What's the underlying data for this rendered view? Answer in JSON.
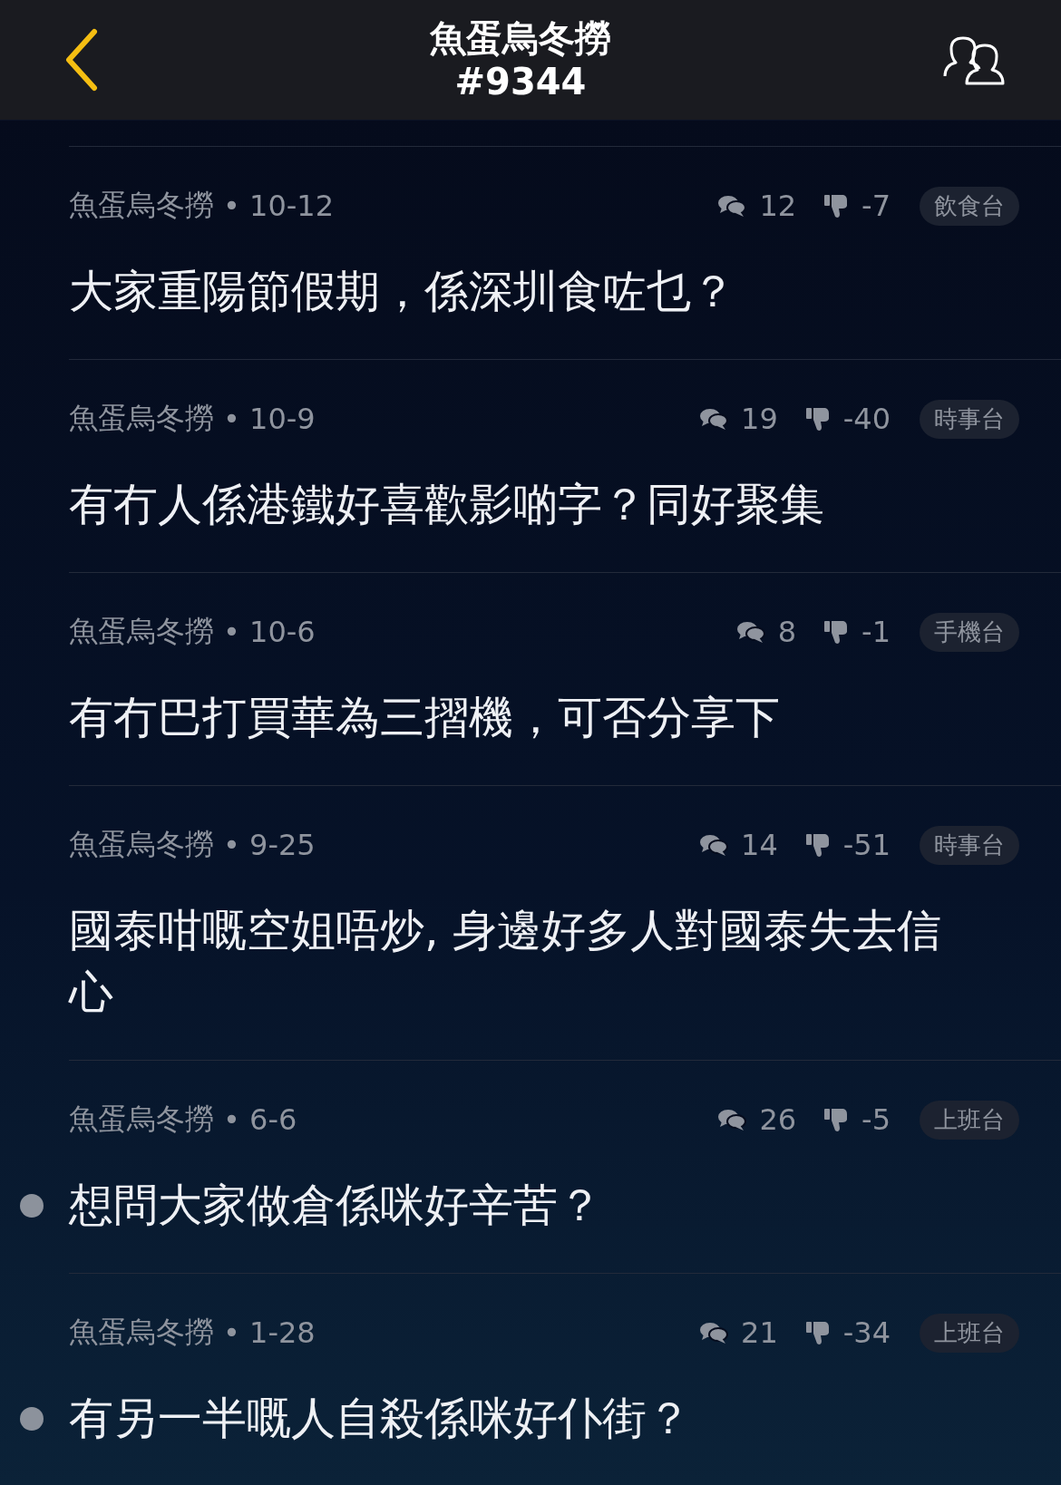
{
  "header": {
    "title": "魚蛋烏冬撈",
    "subtitle": "#9344"
  },
  "posts": [
    {
      "author": "魚蛋烏冬撈",
      "date": "• 10-12",
      "comments": "12",
      "score": "-7",
      "board": "飲食台",
      "title": "大家重陽節假期，係深圳食咗乜？",
      "unread": false
    },
    {
      "author": "魚蛋烏冬撈",
      "date": "• 10-9",
      "comments": "19",
      "score": "-40",
      "board": "時事台",
      "title": "有冇人係港鐵好喜歡影啲字？同好聚集",
      "unread": false
    },
    {
      "author": "魚蛋烏冬撈",
      "date": "• 10-6",
      "comments": "8",
      "score": "-1",
      "board": "手機台",
      "title": "有冇巴打買華為三摺機，可否分享下",
      "unread": false
    },
    {
      "author": "魚蛋烏冬撈",
      "date": "• 9-25",
      "comments": "14",
      "score": "-51",
      "board": "時事台",
      "title": "國泰咁嘅空姐唔炒, 身邊好多人對國泰失去信心",
      "unread": false
    },
    {
      "author": "魚蛋烏冬撈",
      "date": "• 6-6",
      "comments": "26",
      "score": "-5",
      "board": "上班台",
      "title": "想問大家做倉係咪好辛苦？",
      "unread": true
    },
    {
      "author": "魚蛋烏冬撈",
      "date": "• 1-28",
      "comments": "21",
      "score": "-34",
      "board": "上班台",
      "title": "有另一半嘅人自殺係咪好仆街？",
      "unread": true
    }
  ]
}
